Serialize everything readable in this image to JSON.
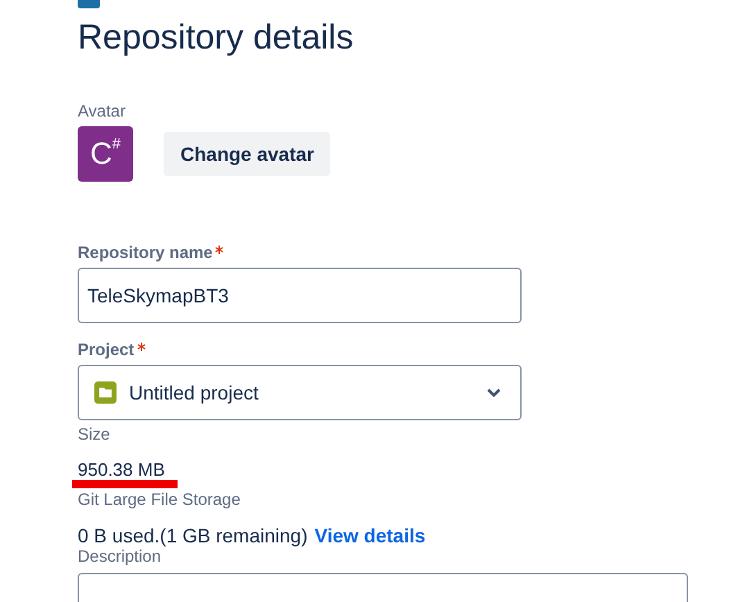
{
  "title": "Repository details",
  "avatar": {
    "label": "Avatar",
    "glyph": "C#",
    "button": "Change avatar"
  },
  "repository_name": {
    "label": "Repository name",
    "required": true,
    "value": "TeleSkymapBT3"
  },
  "project": {
    "label": "Project",
    "required": true,
    "value": "Untitled project"
  },
  "size": {
    "label": "Size",
    "value": "950.38 MB",
    "underlined": true
  },
  "lfs": {
    "label": "Git Large File Storage",
    "usage": "0 B used.(1 GB remaining)",
    "link": "View details"
  },
  "description": {
    "label": "Description"
  }
}
